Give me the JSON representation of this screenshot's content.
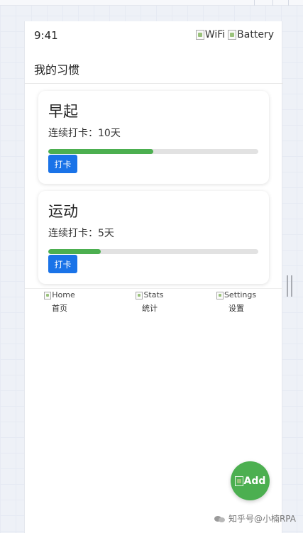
{
  "status_bar": {
    "time": "9:41",
    "wifi_alt": "WiFi",
    "battery_alt": "Battery"
  },
  "header": {
    "title": "我的习惯"
  },
  "habits": [
    {
      "name": "早起",
      "streak": "连续打卡：10天",
      "progress": 0.5,
      "button": "打卡"
    },
    {
      "name": "运动",
      "streak": "连续打卡：5天",
      "progress": 0.25,
      "button": "打卡"
    }
  ],
  "nav": [
    {
      "alt": "Home",
      "label": "首页",
      "icon": "home-icon"
    },
    {
      "alt": "Stats",
      "label": "统计",
      "icon": "stats-icon"
    },
    {
      "alt": "Settings",
      "label": "设置",
      "icon": "settings-icon"
    }
  ],
  "fab": {
    "alt": "Add",
    "icon": "add-icon"
  },
  "watermark": {
    "text": "知乎号@小楠RPA"
  },
  "colors": {
    "accent_blue": "#1a73e8",
    "progress_green": "#4caf50",
    "fab_green": "#4caf50"
  }
}
